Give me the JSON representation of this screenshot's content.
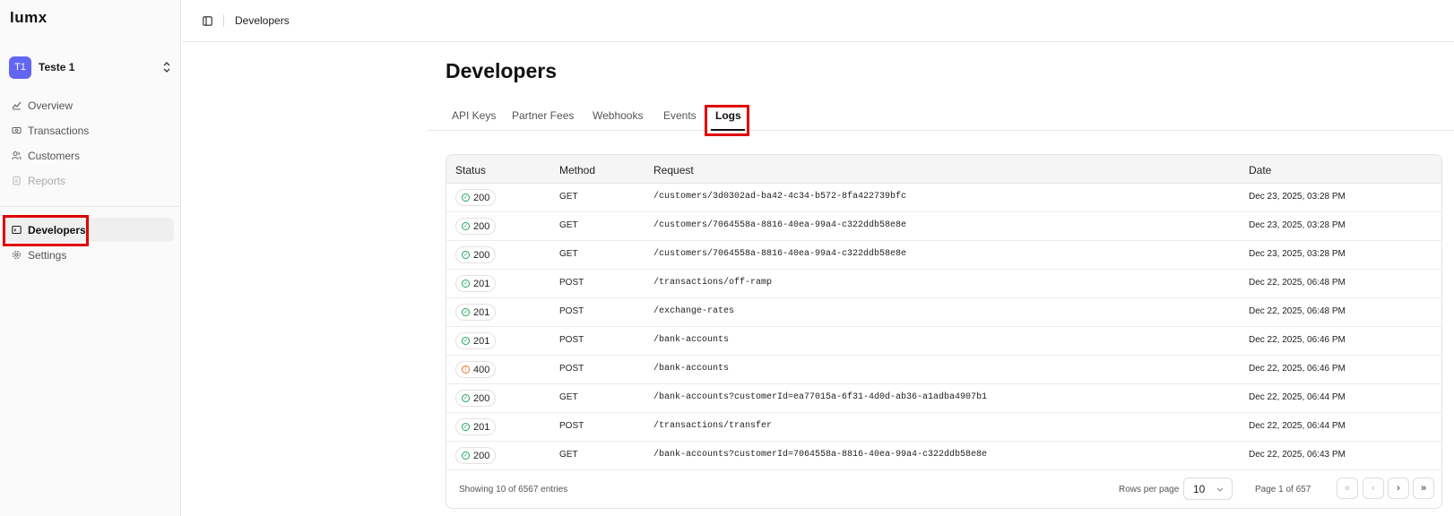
{
  "app": {
    "logo": "LUMX"
  },
  "org": {
    "initials": "T1",
    "name": "Teste 1"
  },
  "sidebar": {
    "items": [
      {
        "label": "Overview",
        "icon": "overview-icon"
      },
      {
        "label": "Transactions",
        "icon": "transactions-icon"
      },
      {
        "label": "Customers",
        "icon": "customers-icon"
      },
      {
        "label": "Reports",
        "icon": "reports-icon",
        "disabled": true
      },
      {
        "label": "Developers",
        "icon": "terminal-icon",
        "active": true
      },
      {
        "label": "Settings",
        "icon": "gear-icon"
      }
    ]
  },
  "topbar": {
    "breadcrumb": "Developers"
  },
  "page": {
    "title": "Developers"
  },
  "tabs": [
    {
      "label": "API Keys"
    },
    {
      "label": "Partner Fees"
    },
    {
      "label": "Webhooks"
    },
    {
      "label": "Events"
    },
    {
      "label": "Logs",
      "active": true
    }
  ],
  "table": {
    "columns": [
      "Status",
      "Method",
      "Request",
      "Date"
    ],
    "rows": [
      {
        "status": "200",
        "method": "GET",
        "request": "/customers/3d0302ad-ba42-4c34-b572-8fa422739bfc",
        "date": "Dec 23, 2025, 03:28 PM"
      },
      {
        "status": "200",
        "method": "GET",
        "request": "/customers/7064558a-8816-40ea-99a4-c322ddb58e8e",
        "date": "Dec 23, 2025, 03:28 PM"
      },
      {
        "status": "200",
        "method": "GET",
        "request": "/customers/7064558a-8816-40ea-99a4-c322ddb58e8e",
        "date": "Dec 23, 2025, 03:28 PM"
      },
      {
        "status": "201",
        "method": "POST",
        "request": "/transactions/off-ramp",
        "date": "Dec 22, 2025, 06:48 PM"
      },
      {
        "status": "201",
        "method": "POST",
        "request": "/exchange-rates",
        "date": "Dec 22, 2025, 06:48 PM"
      },
      {
        "status": "201",
        "method": "POST",
        "request": "/bank-accounts",
        "date": "Dec 22, 2025, 06:46 PM"
      },
      {
        "status": "400",
        "method": "POST",
        "request": "/bank-accounts",
        "date": "Dec 22, 2025, 06:46 PM"
      },
      {
        "status": "200",
        "method": "GET",
        "request": "/bank-accounts?customerId=ea77015a-6f31-4d0d-ab36-a1adba4907b1",
        "date": "Dec 22, 2025, 06:44 PM"
      },
      {
        "status": "201",
        "method": "POST",
        "request": "/transactions/transfer",
        "date": "Dec 22, 2025, 06:44 PM"
      },
      {
        "status": "200",
        "method": "GET",
        "request": "/bank-accounts?customerId=7064558a-8816-40ea-99a4-c322ddb58e8e",
        "date": "Dec 22, 2025, 06:43 PM"
      }
    ]
  },
  "pagination": {
    "showing": "Showing 10 of 6567 entries",
    "rows_per_page_label": "Rows per page",
    "rows_per_page": "10",
    "page_info": "Page 1 of 657",
    "first": "«",
    "prev": "‹",
    "next": "›",
    "last": "»"
  },
  "colors": {
    "accent": "#6366f1",
    "success": "#22a85a",
    "warning": "#e8742c",
    "highlight": "#e00000"
  }
}
